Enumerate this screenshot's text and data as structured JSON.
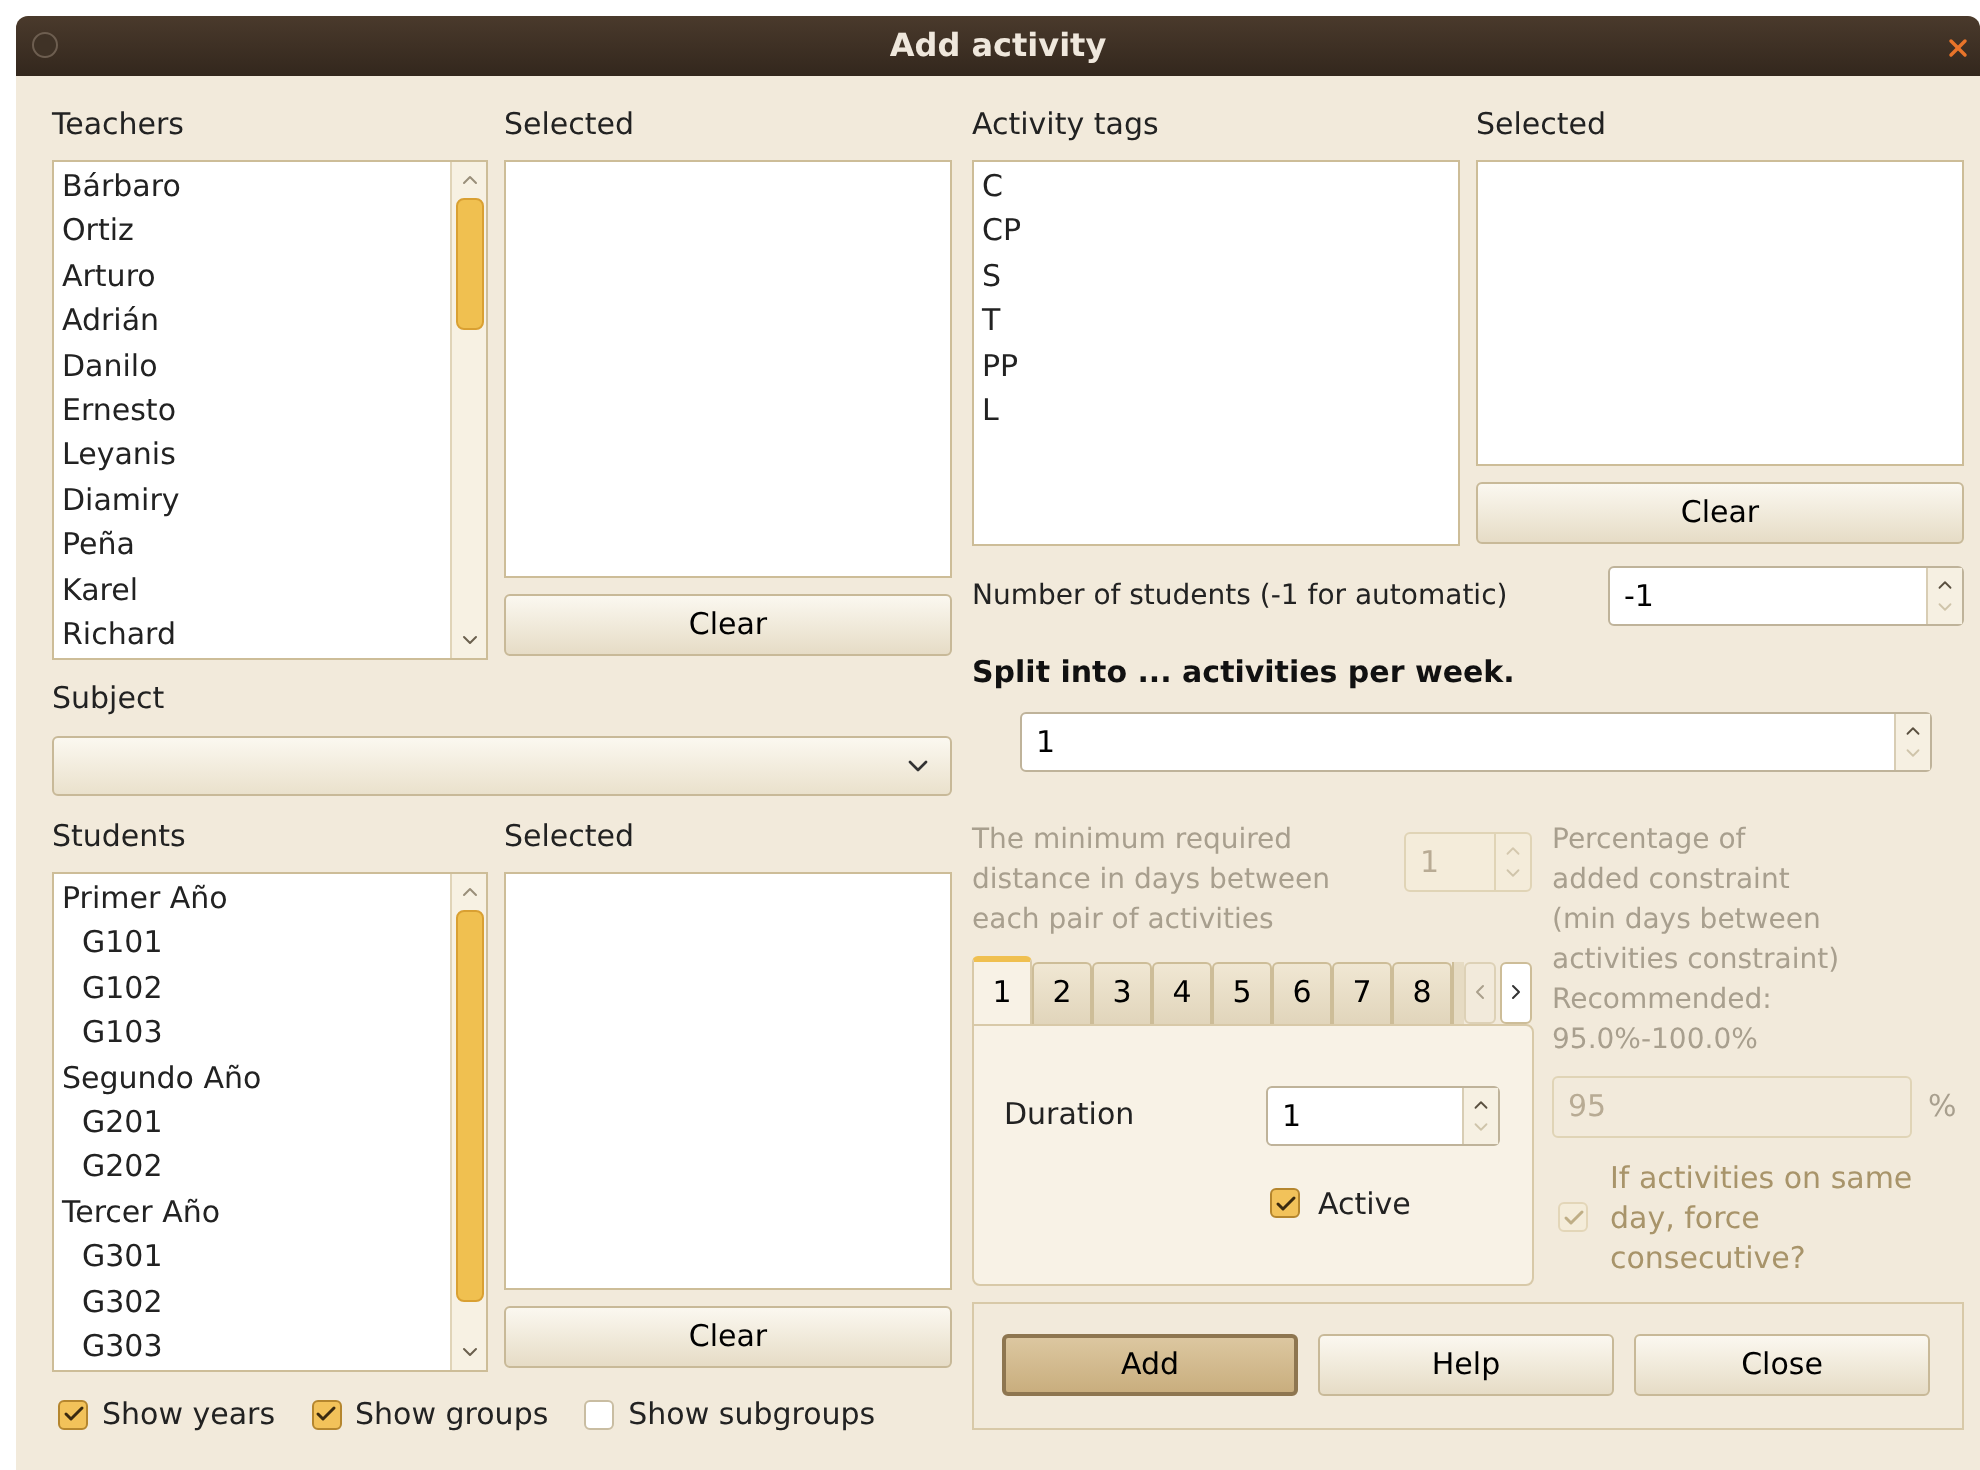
{
  "window": {
    "title": "Add activity"
  },
  "teachers": {
    "label": "Teachers",
    "items": [
      "Bárbaro",
      "Ortiz",
      "Arturo",
      "Adrián",
      "Danilo",
      "Ernesto",
      "Leyanis",
      "Diamiry",
      "Peña",
      "Karel",
      "Richard"
    ]
  },
  "teachers_selected": {
    "label": "Selected",
    "clear_button": "Clear"
  },
  "subject": {
    "label": "Subject"
  },
  "students": {
    "label": "Students",
    "items": [
      {
        "label": "Primer Año",
        "children": [
          {
            "label": "G101"
          },
          {
            "label": "G102"
          },
          {
            "label": "G103"
          }
        ]
      },
      {
        "label": "Segundo Año",
        "children": [
          {
            "label": "G201"
          },
          {
            "label": "G202"
          }
        ]
      },
      {
        "label": "Tercer Año",
        "children": [
          {
            "label": "G301"
          },
          {
            "label": "G302"
          },
          {
            "label": "G303"
          }
        ]
      }
    ]
  },
  "students_selected": {
    "label": "Selected",
    "clear_button": "Clear"
  },
  "student_options": [
    {
      "label": "Show years",
      "checked": true
    },
    {
      "label": "Show groups",
      "checked": true
    },
    {
      "label": "Show subgroups",
      "checked": false
    }
  ],
  "activity_tags": {
    "label": "Activity tags",
    "items": [
      "C",
      "CP",
      "S",
      "T",
      "PP",
      "L"
    ]
  },
  "tags_selected": {
    "label": "Selected",
    "clear_button": "Clear"
  },
  "number_of_students": {
    "label": "Number of students (-1 for automatic)",
    "value": "-1"
  },
  "split": {
    "label": "Split into ... activities per week.",
    "value": "1"
  },
  "min_days": {
    "label": "The minimum required distance in days between each pair of activities",
    "value": "1",
    "disabled": true
  },
  "tabs": [
    {
      "label": "1",
      "selected": true
    },
    {
      "label": "2",
      "selected": false
    },
    {
      "label": "3",
      "selected": false
    },
    {
      "label": "4",
      "selected": false
    },
    {
      "label": "5",
      "selected": false
    },
    {
      "label": "6",
      "selected": false
    },
    {
      "label": "7",
      "selected": false
    },
    {
      "label": "8",
      "selected": false
    }
  ],
  "duration": {
    "label": "Duration",
    "value": "1"
  },
  "active": {
    "label": "Active",
    "checked": true
  },
  "percentage": {
    "label": "Percentage of\nadded constraint\n (min days between\nactivities constraint)\nRecommended:\n95.0%-100.0%",
    "value": "95",
    "unit": "%",
    "disabled": true
  },
  "consecutive": {
    "label": "If activities on same day, force consecutive?",
    "checked": true,
    "disabled": true
  },
  "buttons": [
    {
      "label": "Add",
      "default": true
    },
    {
      "label": "Help",
      "default": false
    },
    {
      "label": "Close",
      "default": false
    }
  ]
}
